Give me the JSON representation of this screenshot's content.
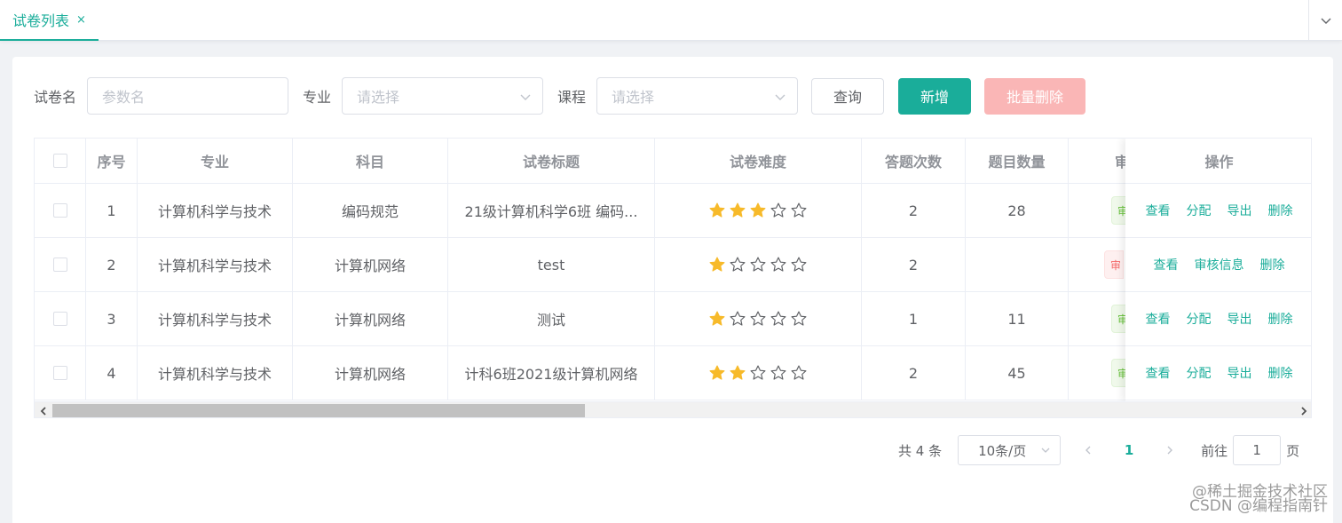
{
  "tabs": [
    {
      "label": "试卷列表",
      "close": "×"
    }
  ],
  "search": {
    "name_label": "试卷名",
    "name_placeholder": "参数名",
    "major_label": "专业",
    "major_placeholder": "请选择",
    "course_label": "课程",
    "course_placeholder": "请选择",
    "query_button": "查询",
    "add_button": "新增",
    "batch_delete_button": "批量删除"
  },
  "table": {
    "headers": [
      "序号",
      "专业",
      "科目",
      "试卷标题",
      "试卷难度",
      "答题次数",
      "题目数量",
      "审",
      "操作"
    ],
    "rows": [
      {
        "index": "1",
        "major": "计算机科学与技术",
        "subject": "编码规范",
        "title": "21级计算机科学6班 编码...",
        "difficulty": 3,
        "attempts": "2",
        "questions": "28",
        "audit_tag": "审",
        "audit_status": "approved",
        "ops": [
          "查看",
          "分配",
          "导出",
          "删除"
        ]
      },
      {
        "index": "2",
        "major": "计算机科学与技术",
        "subject": "计算机网络",
        "title": "test",
        "difficulty": 1,
        "attempts": "2",
        "questions": "",
        "audit_tag": "审",
        "audit_status": "rejected",
        "ops": [
          "查看",
          "审核信息",
          "删除"
        ]
      },
      {
        "index": "3",
        "major": "计算机科学与技术",
        "subject": "计算机网络",
        "title": "测试",
        "difficulty": 1,
        "attempts": "1",
        "questions": "11",
        "audit_tag": "审",
        "audit_status": "approved",
        "ops": [
          "查看",
          "分配",
          "导出",
          "删除"
        ]
      },
      {
        "index": "4",
        "major": "计算机科学与技术",
        "subject": "计算机网络",
        "title": "计科6班2021级计算机网络",
        "difficulty": 2,
        "attempts": "2",
        "questions": "45",
        "audit_tag": "审",
        "audit_status": "approved",
        "ops": [
          "查看",
          "分配",
          "导出",
          "删除"
        ]
      }
    ],
    "max_difficulty": 5
  },
  "pagination": {
    "total_text": "共 4 条",
    "page_size": "10条/页",
    "current_page": "1",
    "goto_label": "前往",
    "goto_value": "1",
    "page_suffix": "页"
  },
  "watermark": {
    "line1": "@稀土掘金技术社区",
    "line2": "CSDN @编程指南针"
  },
  "colors": {
    "primary": "#1aad9a",
    "danger_disabled": "#fab6b6",
    "star": "#f7ba2a"
  }
}
